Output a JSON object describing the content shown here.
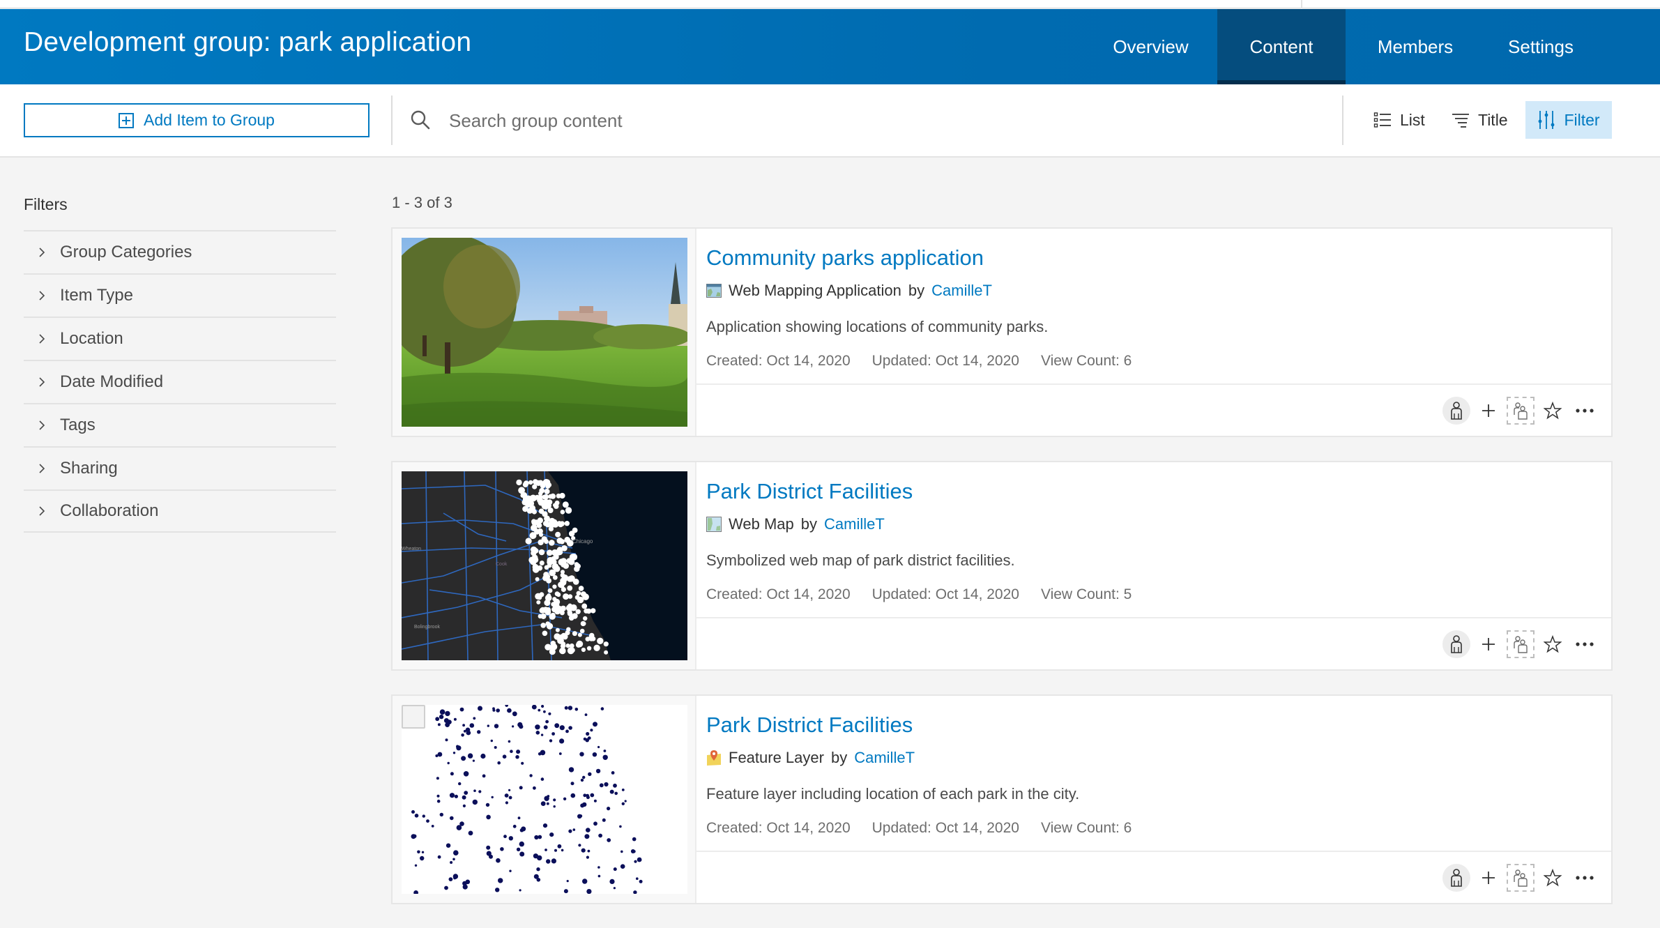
{
  "header": {
    "title": "Development group: park application",
    "tabs": [
      {
        "label": "Overview",
        "active": false
      },
      {
        "label": "Content",
        "active": true
      },
      {
        "label": "Members",
        "active": false
      },
      {
        "label": "Settings",
        "active": false
      }
    ],
    "accent_color": "#0079c1",
    "active_tab_color": "#054d7e"
  },
  "toolbar": {
    "add_item_label": "Add Item to Group",
    "search_placeholder": "Search group content",
    "search_value": "",
    "view_label": "List",
    "sort_label": "Title",
    "filter_label": "Filter"
  },
  "sidebar": {
    "heading": "Filters",
    "items": [
      {
        "label": "Group Categories"
      },
      {
        "label": "Item Type"
      },
      {
        "label": "Location"
      },
      {
        "label": "Date Modified"
      },
      {
        "label": "Tags"
      },
      {
        "label": "Sharing"
      },
      {
        "label": "Collaboration"
      }
    ]
  },
  "results": {
    "count_label": "1 - 3 of 3",
    "items": [
      {
        "title": "Community parks application",
        "type": "Web Mapping Application",
        "type_icon": "web-mapping-application-icon",
        "by": "by",
        "owner": "CamilleT",
        "snippet": "Application showing locations of community parks.",
        "created": "Created: Oct 14, 2020",
        "updated": "Updated: Oct 14, 2020",
        "views": "View Count: 6",
        "thumbnail": "park-photo"
      },
      {
        "title": "Park District Facilities",
        "type": "Web Map",
        "type_icon": "web-map-icon",
        "by": "by",
        "owner": "CamilleT",
        "snippet": "Symbolized web map of park district facilities.",
        "created": "Created: Oct 14, 2020",
        "updated": "Updated: Oct 14, 2020",
        "views": "View Count: 5",
        "thumbnail": "dark-map-white-points"
      },
      {
        "title": "Park District Facilities",
        "type": "Feature Layer",
        "type_icon": "feature-layer-icon",
        "by": "by",
        "owner": "CamilleT",
        "snippet": "Feature layer including location of each park in the city.",
        "created": "Created: Oct 14, 2020",
        "updated": "Updated: Oct 14, 2020",
        "views": "View Count: 6",
        "thumbnail": "white-map-navy-points",
        "selectable": true
      }
    ],
    "actions": [
      "sharing-private-icon",
      "add-icon",
      "share-to-group-icon",
      "favorite-star-icon",
      "more-options-icon"
    ]
  }
}
